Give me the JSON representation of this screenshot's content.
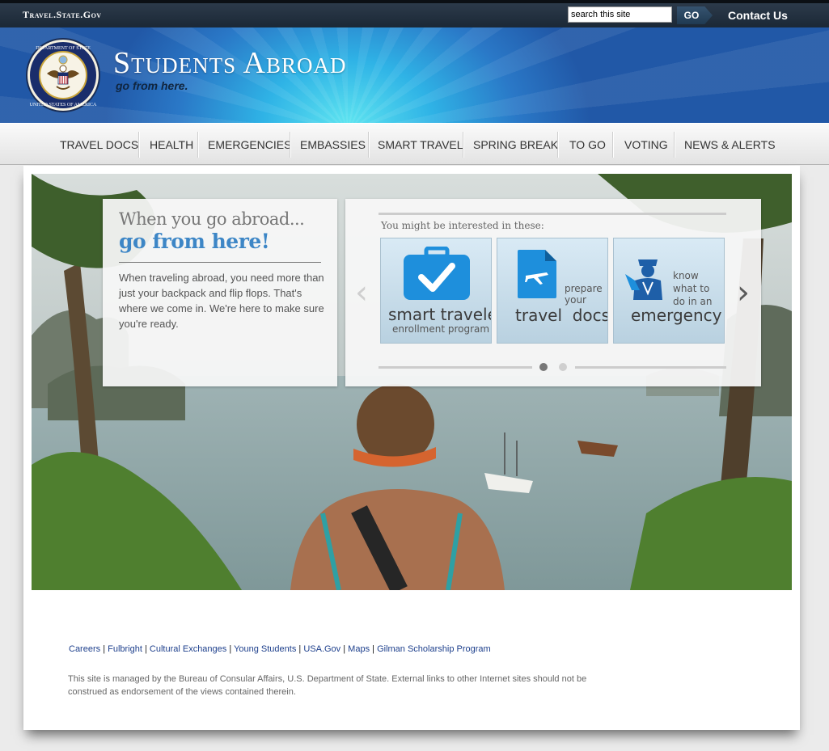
{
  "topbar": {
    "site_link": "Travel.State.Gov",
    "search": {
      "placeholder": "search this site",
      "value": "search this site"
    },
    "go_label": "GO",
    "contact_label": "Contact Us"
  },
  "header": {
    "title": "Students Abroad",
    "tagline": "go from here."
  },
  "nav": {
    "items": [
      {
        "label": "TRAVEL DOCS"
      },
      {
        "label": "HEALTH"
      },
      {
        "label": "EMERGENCIES"
      },
      {
        "label": "EMBASSIES"
      },
      {
        "label": "SMART TRAVEL"
      },
      {
        "label": "SPRING BREAK"
      },
      {
        "label": "TO GO"
      },
      {
        "label": "VOTING"
      },
      {
        "label": "NEWS & ALERTS"
      }
    ]
  },
  "hero": {
    "intro": {
      "heading": "When you go abroad...",
      "subheading": "go from here!",
      "body": "When traveling abroad, you need more than just your backpack and flip flops. That's where we come in. We're here to make sure you're ready."
    },
    "carousel": {
      "label": "You might be interested in these:",
      "tiles": [
        {
          "icon": "briefcase-check-icon",
          "title": "smart traveler",
          "subtitle": "enrollment program"
        },
        {
          "icon": "document-plane-icon",
          "pre": "prepare your",
          "title": "travel  docs"
        },
        {
          "icon": "officer-icon",
          "pre": "know what to do in an",
          "title": "emergency"
        }
      ],
      "prev_icon": "chevron-left-icon",
      "next_icon": "chevron-right-icon",
      "pages": 2,
      "active_page": 1
    }
  },
  "footer": {
    "links": [
      "Careers",
      "Fulbright",
      "Cultural Exchanges",
      "Young Students",
      "USA.Gov",
      "Maps",
      "Gilman Scholarship Program"
    ],
    "disclaimer": "This site is managed by the Bureau of Consular Affairs, U.S. Department of State. External links to other Internet sites should not be construed as endorsement of the views contained therein."
  },
  "colors": {
    "header_blue": "#2a78c7",
    "accent_blue": "#3d86c6",
    "tile_blue": "#1e8fdc",
    "link_blue": "#1d3f8c"
  }
}
